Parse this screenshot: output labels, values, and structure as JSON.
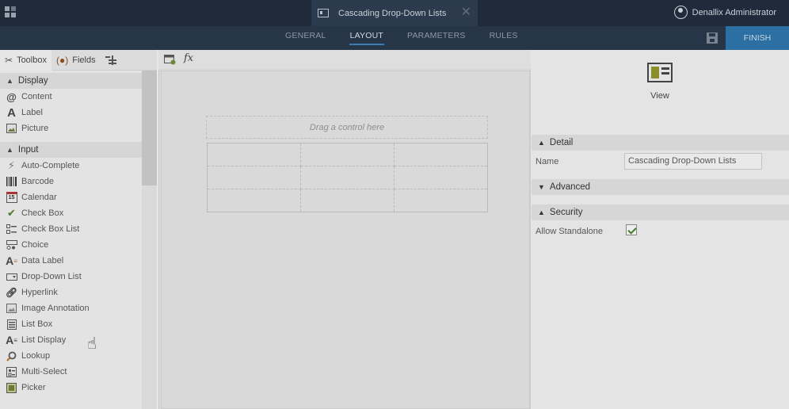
{
  "topbar": {
    "document_title": "Cascading Drop-Down Lists",
    "user_name": "Denallix Administrator"
  },
  "nav": {
    "tabs": [
      {
        "label": "GENERAL",
        "active": false
      },
      {
        "label": "LAYOUT",
        "active": true
      },
      {
        "label": "PARAMETERS",
        "active": false
      },
      {
        "label": "RULES",
        "active": false
      }
    ],
    "finish_label": "FINISH"
  },
  "left_panel": {
    "tabs": {
      "toolbox": "Toolbox",
      "fields": "Fields"
    },
    "display_section": "Display",
    "display_items": [
      "Content",
      "Label",
      "Picture"
    ],
    "input_section": "Input",
    "input_items": [
      "Auto-Complete",
      "Barcode",
      "Calendar",
      "Check Box",
      "Check Box List",
      "Choice",
      "Data Label",
      "Drop-Down List",
      "Hyperlink",
      "Image Annotation",
      "List Box",
      "List Display",
      "Lookup",
      "Multi-Select",
      "Picker"
    ],
    "calendar_icon_text": "15"
  },
  "canvas": {
    "drop_hint": "Drag a control here",
    "fx_label": "fx"
  },
  "right_panel": {
    "view_label": "View",
    "detail_section": "Detail",
    "name_label": "Name",
    "name_value": "Cascading Drop-Down Lists",
    "advanced_section": "Advanced",
    "security_section": "Security",
    "allow_standalone_label": "Allow Standalone",
    "allow_standalone_checked": true
  },
  "colors": {
    "topbar_bg": "#1f2a3a",
    "navbar_bg": "#273549",
    "finish_bg": "#2b6fa3",
    "active_tab_underline": "#3d7fb5"
  }
}
